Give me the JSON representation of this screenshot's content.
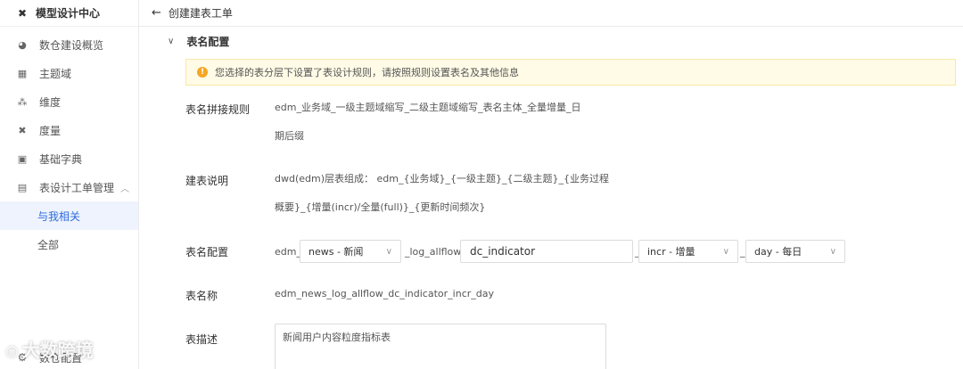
{
  "sidebar": {
    "brand": {
      "label": "模型设计中心",
      "icon": "tools-icon"
    },
    "items": [
      {
        "label": "数仓建设概览",
        "icon": "dashboard-icon"
      },
      {
        "label": "主题域",
        "icon": "grid-icon"
      },
      {
        "label": "维度",
        "icon": "nodes-icon"
      },
      {
        "label": "度量",
        "icon": "tools-icon"
      },
      {
        "label": "基础字典",
        "icon": "save-icon"
      },
      {
        "label": "表设计工单管理",
        "icon": "table-icon",
        "expanded": true
      }
    ],
    "sub_items": [
      {
        "label": "与我相关",
        "active": true
      },
      {
        "label": "全部",
        "active": false
      }
    ],
    "bottom": {
      "label": "数仓配置",
      "icon": "settings-icon"
    }
  },
  "header": {
    "title": "创建建表工单"
  },
  "section": {
    "label": "表名配置"
  },
  "notice": {
    "text": "您选择的表分层下设置了表设计规则，请按照规则设置表名及其他信息"
  },
  "form": {
    "rule": {
      "label": "表名拼接规则",
      "line1": "edm_业务域_一级主题域缩写_二级主题域缩写_表名主体_全量增量_日",
      "line2": "期后缀"
    },
    "desc": {
      "label": "建表说明",
      "line1": "dwd(edm)层表组成： edm_{业务域}_{一级主题}_{二级主题}_{业务过程",
      "line2": "概要}_{增量(incr)/全量(full)}_{更新时间频次}"
    },
    "config": {
      "label": "表名配置",
      "prefix": "edm_",
      "domain_select": "news - 新闻",
      "mid": "_log_allflow_",
      "subject_input": "dc_indicator",
      "sep1": "_",
      "incr_select": "incr - 增量",
      "sep2": "_",
      "freq_select": "day - 每日"
    },
    "name": {
      "label": "表名称",
      "value": "edm_news_log_allflow_dc_indicator_incr_day"
    },
    "description": {
      "label": "表描述",
      "value": "新闻用户内容粒度指标表"
    }
  },
  "watermark": {
    "text": "大数跨境"
  }
}
